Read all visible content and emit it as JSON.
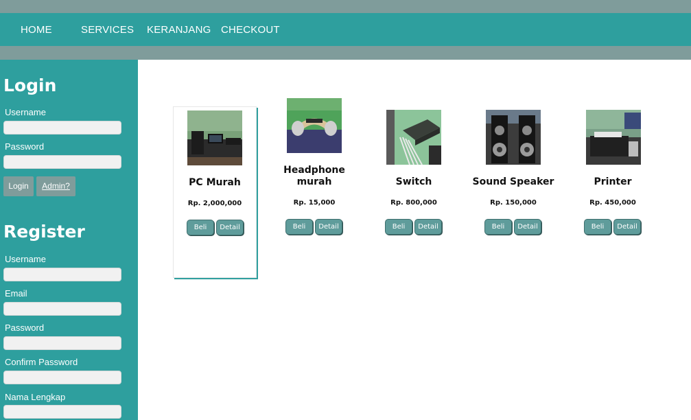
{
  "nav": {
    "items": [
      {
        "label": "HOME"
      },
      {
        "label": "SERVICES"
      },
      {
        "label": "KERANJANG"
      },
      {
        "label": "CHECKOUT"
      }
    ]
  },
  "sidebar": {
    "login": {
      "title": "Login",
      "username_label": "Username",
      "username_value": "",
      "password_label": "Password",
      "password_value": "",
      "login_button": "Login",
      "admin_link": "Admin?"
    },
    "register": {
      "title": "Register",
      "username_label": "Username",
      "username_value": "",
      "email_label": "Email",
      "email_value": "",
      "password_label": "Password",
      "password_value": "",
      "confirm_label": "Confirm Password",
      "confirm_value": "",
      "fullname_label": "Nama Lengkap",
      "fullname_value": ""
    }
  },
  "products": [
    {
      "name": "PC Murah",
      "price": "Rp. 2,000,000",
      "buy_label": "Beli",
      "detail_label": "Detail",
      "image": "pc-photo"
    },
    {
      "name": "Headphone murah",
      "price": "Rp. 15,000",
      "buy_label": "Beli",
      "detail_label": "Detail",
      "image": "headphone-photo"
    },
    {
      "name": "Switch",
      "price": "Rp. 800,000",
      "buy_label": "Beli",
      "detail_label": "Detail",
      "image": "switch-photo"
    },
    {
      "name": "Sound Speaker",
      "price": "Rp. 150,000",
      "buy_label": "Beli",
      "detail_label": "Detail",
      "image": "speaker-photo"
    },
    {
      "name": "Printer",
      "price": "Rp. 450,000",
      "buy_label": "Beli",
      "detail_label": "Detail",
      "image": "printer-photo"
    }
  ],
  "colors": {
    "teal": "#2e9f9e",
    "strip": "#7f9c9b",
    "button": "#5f9c9b",
    "input_bg": "#f1f1f1"
  }
}
